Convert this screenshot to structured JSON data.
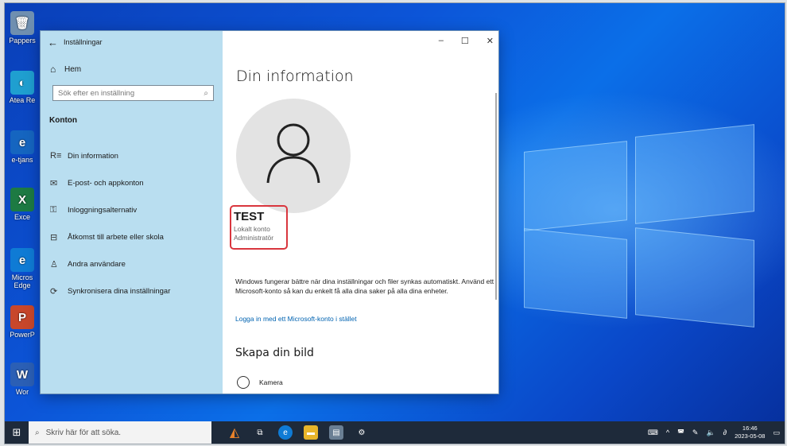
{
  "desktop": {
    "icons": [
      {
        "label": "Pappers",
        "color": "#6f8fb0",
        "glyph": "🗑"
      },
      {
        "label": "Atea Re",
        "color": "#1f9fd0",
        "glyph": "◐"
      },
      {
        "label": "e-tjans",
        "color": "#1565c0",
        "glyph": "e"
      },
      {
        "label": "Exce",
        "color": "#1d7a43",
        "glyph": "X"
      },
      {
        "label": "Micros Edge",
        "color": "#0f7bd5",
        "glyph": "e"
      },
      {
        "label": "PowerP",
        "color": "#c8472b",
        "glyph": "P"
      },
      {
        "label": "Wor",
        "color": "#2b5fb5",
        "glyph": "W"
      }
    ]
  },
  "window": {
    "title": "Inställningar",
    "minimize": "–",
    "maximize": "☐",
    "close": "✕"
  },
  "sidebar": {
    "home": "Hem",
    "search_placeholder": "Sök efter en inställning",
    "section": "Konton",
    "items": [
      {
        "label": "Din information",
        "icon": "user-card-icon",
        "glyph": "R≡"
      },
      {
        "label": "E-post- och appkonton",
        "icon": "mail-icon",
        "glyph": "✉"
      },
      {
        "label": "Inloggningsalternativ",
        "icon": "key-icon",
        "glyph": "⚿"
      },
      {
        "label": "Åtkomst till arbete eller skola",
        "icon": "briefcase-icon",
        "glyph": "⊟"
      },
      {
        "label": "Andra användare",
        "icon": "add-user-icon",
        "glyph": "♙"
      },
      {
        "label": "Synkronisera dina inställningar",
        "icon": "sync-icon",
        "glyph": "⟳"
      }
    ]
  },
  "main": {
    "heading": "Din information",
    "user_name": "TEST",
    "account_type": "Lokalt konto",
    "role": "Administratör",
    "info_text": "Windows fungerar bättre när dina inställningar och filer synkas automatiskt. Använd ett Microsoft-konto så kan du enkelt få alla dina saker på alla dina enheter.",
    "link": "Logga in med ett Microsoft-konto i stället",
    "picture_heading": "Skapa din bild",
    "camera_label": "Kamera"
  },
  "taskbar": {
    "search_placeholder": "Skriv här för att söka.",
    "time": "16:46",
    "date": "2023-05-08"
  }
}
